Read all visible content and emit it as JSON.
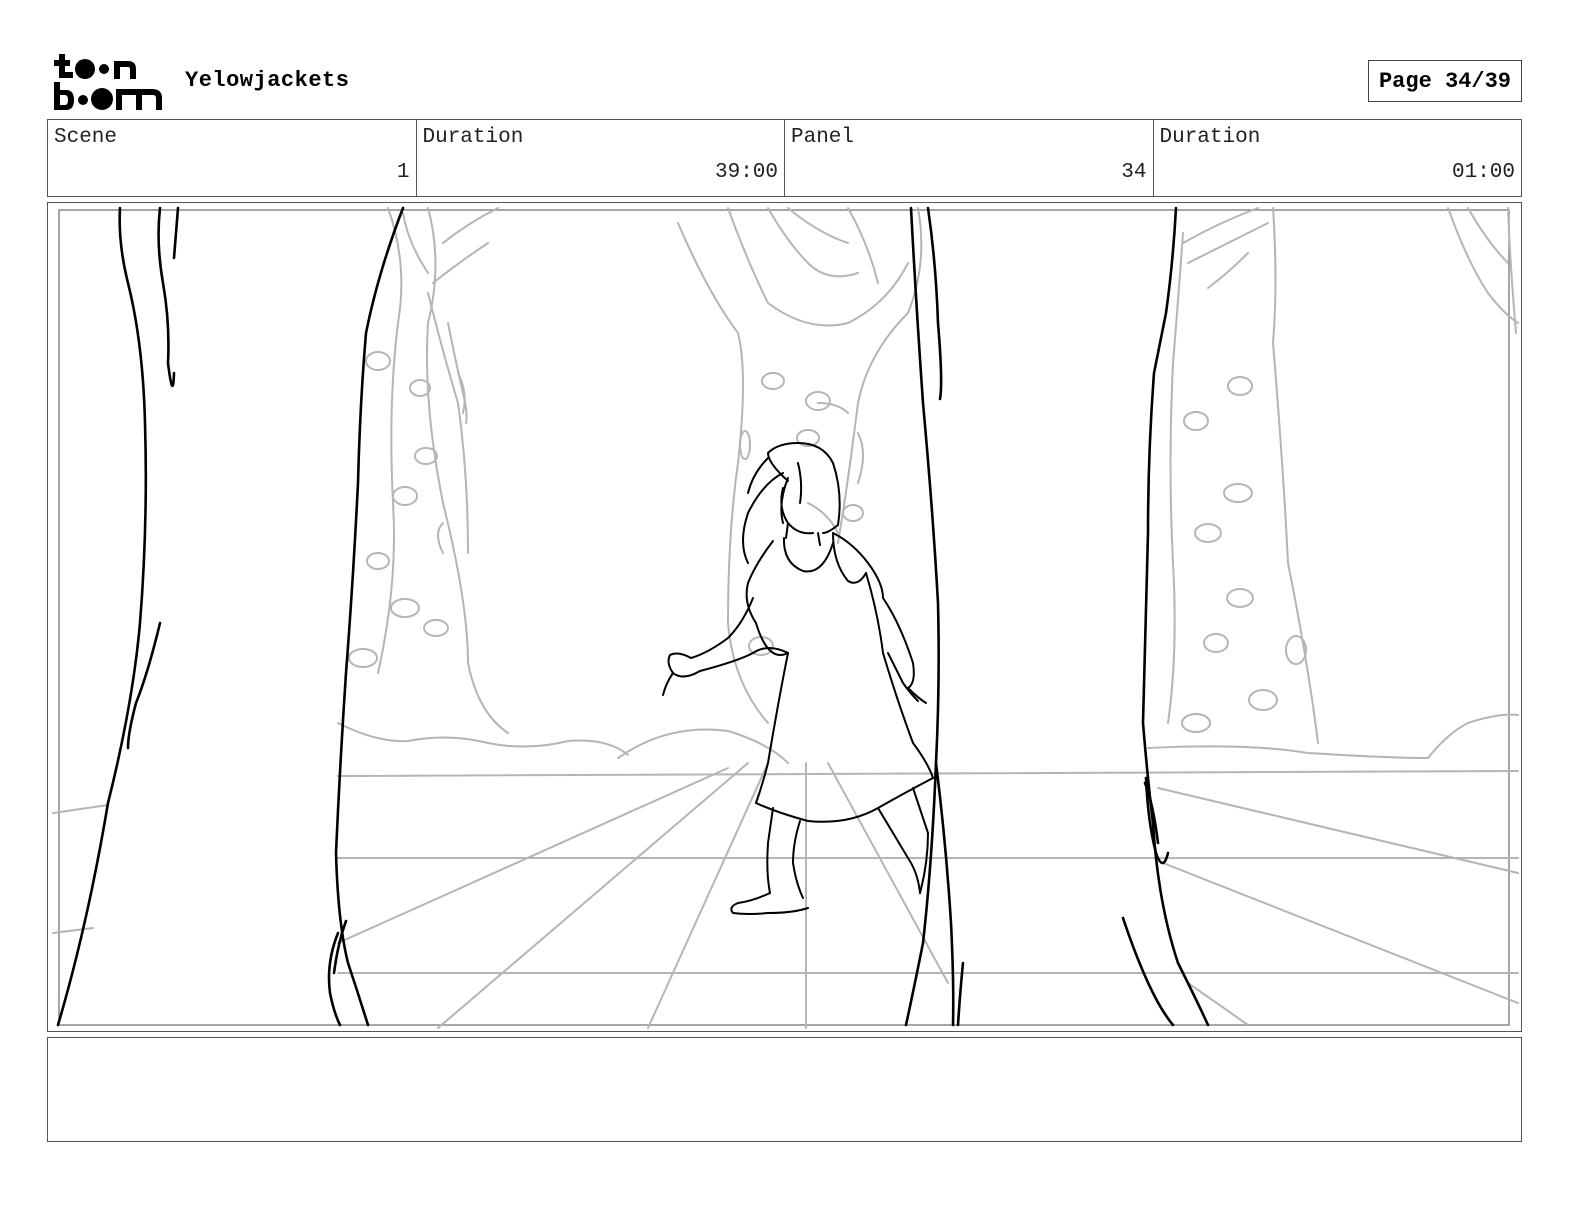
{
  "header": {
    "logo_text_top": "toon",
    "logo_text_bottom": "boom",
    "project_title": "Yelowjackets",
    "page_label": "Page 34/39"
  },
  "info": {
    "scene_label": "Scene",
    "scene_value": "1",
    "scene_duration_label": "Duration",
    "scene_duration_value": "39:00",
    "panel_label": "Panel",
    "panel_value": "34",
    "panel_duration_label": "Duration",
    "panel_duration_value": "01:00"
  },
  "notes": {
    "text": ""
  },
  "colors": {
    "ink": "#000000",
    "sketch": "#b5b5b5",
    "border": "#555555"
  }
}
